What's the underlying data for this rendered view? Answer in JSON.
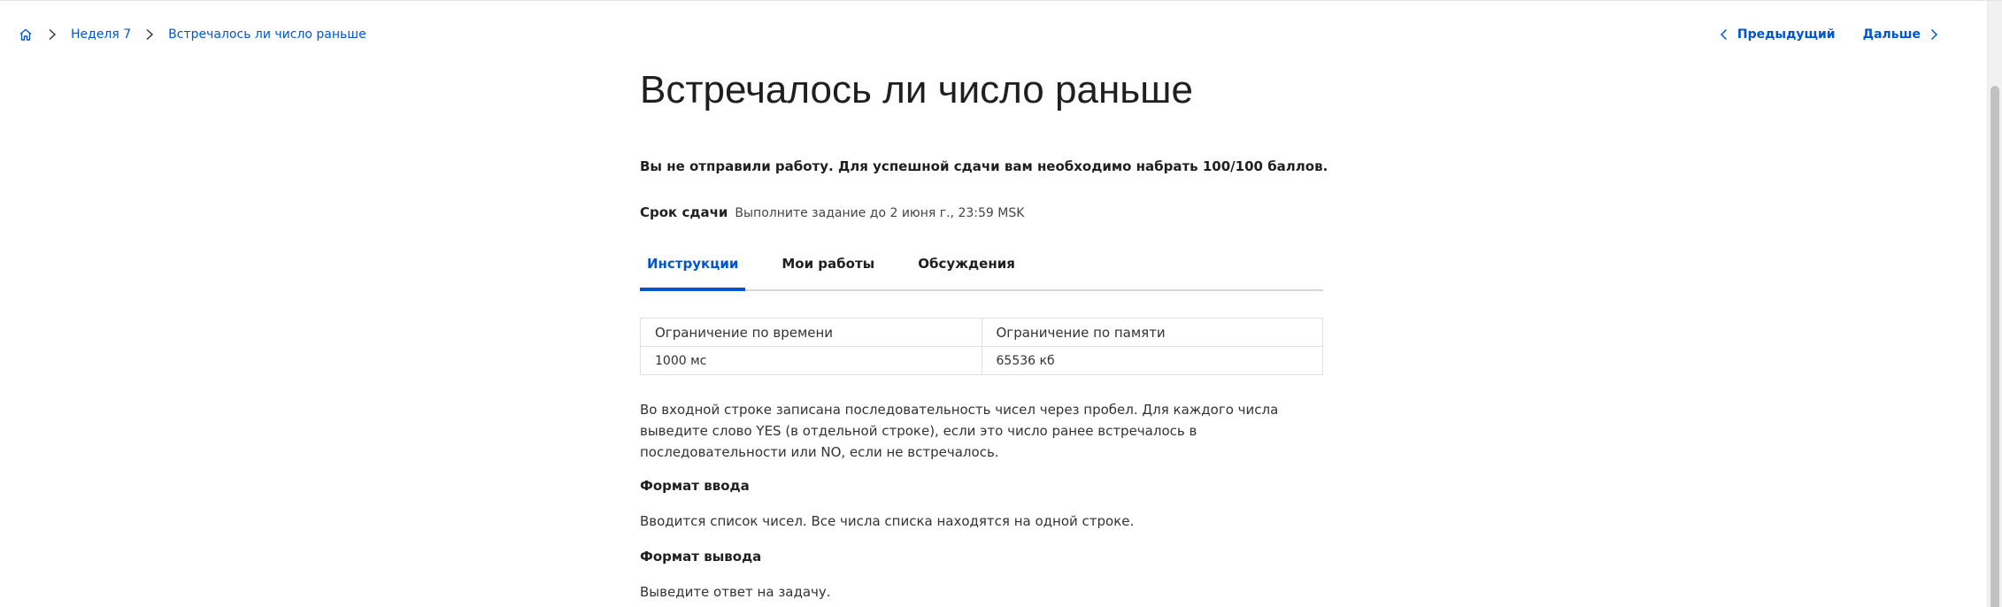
{
  "breadcrumb": {
    "home_icon": "home-icon",
    "items": [
      "Неделя 7",
      "Встречалось ли число раньше"
    ]
  },
  "pager": {
    "prev_label": "Предыдущий",
    "next_label": "Дальше"
  },
  "page": {
    "title": "Встречалось ли число раньше",
    "notice": "Вы не отправили работу. Для успешной сдачи вам необходимо набрать 100/100 баллов.",
    "deadline_label": "Срок сдачи",
    "deadline_value": "Выполните задание до 2 июня г., 23:59 MSK"
  },
  "tabs": [
    {
      "label": "Инструкции",
      "active": true
    },
    {
      "label": "Мои работы",
      "active": false
    },
    {
      "label": "Обсуждения",
      "active": false
    }
  ],
  "limits": {
    "headers": [
      "Ограничение по времени",
      "Ограничение по памяти"
    ],
    "values": [
      "1000 мс",
      "65536 кб"
    ]
  },
  "content": {
    "description": "Во входной строке записана последовательность чисел через пробел. Для каждого числа выведите слово YES (в отдельной строке), если это число ранее встречалось в последовательности или NO, если не встречалось.",
    "input_heading": "Формат ввода",
    "input_text": "Вводится список чисел. Все числа списка находятся на одной строке.",
    "output_heading": "Формат вывода",
    "output_text": "Выведите ответ на задачу."
  },
  "colors": {
    "accent": "#0056d2",
    "text": "#1f1f1f",
    "divider": "#d6d6d6"
  }
}
